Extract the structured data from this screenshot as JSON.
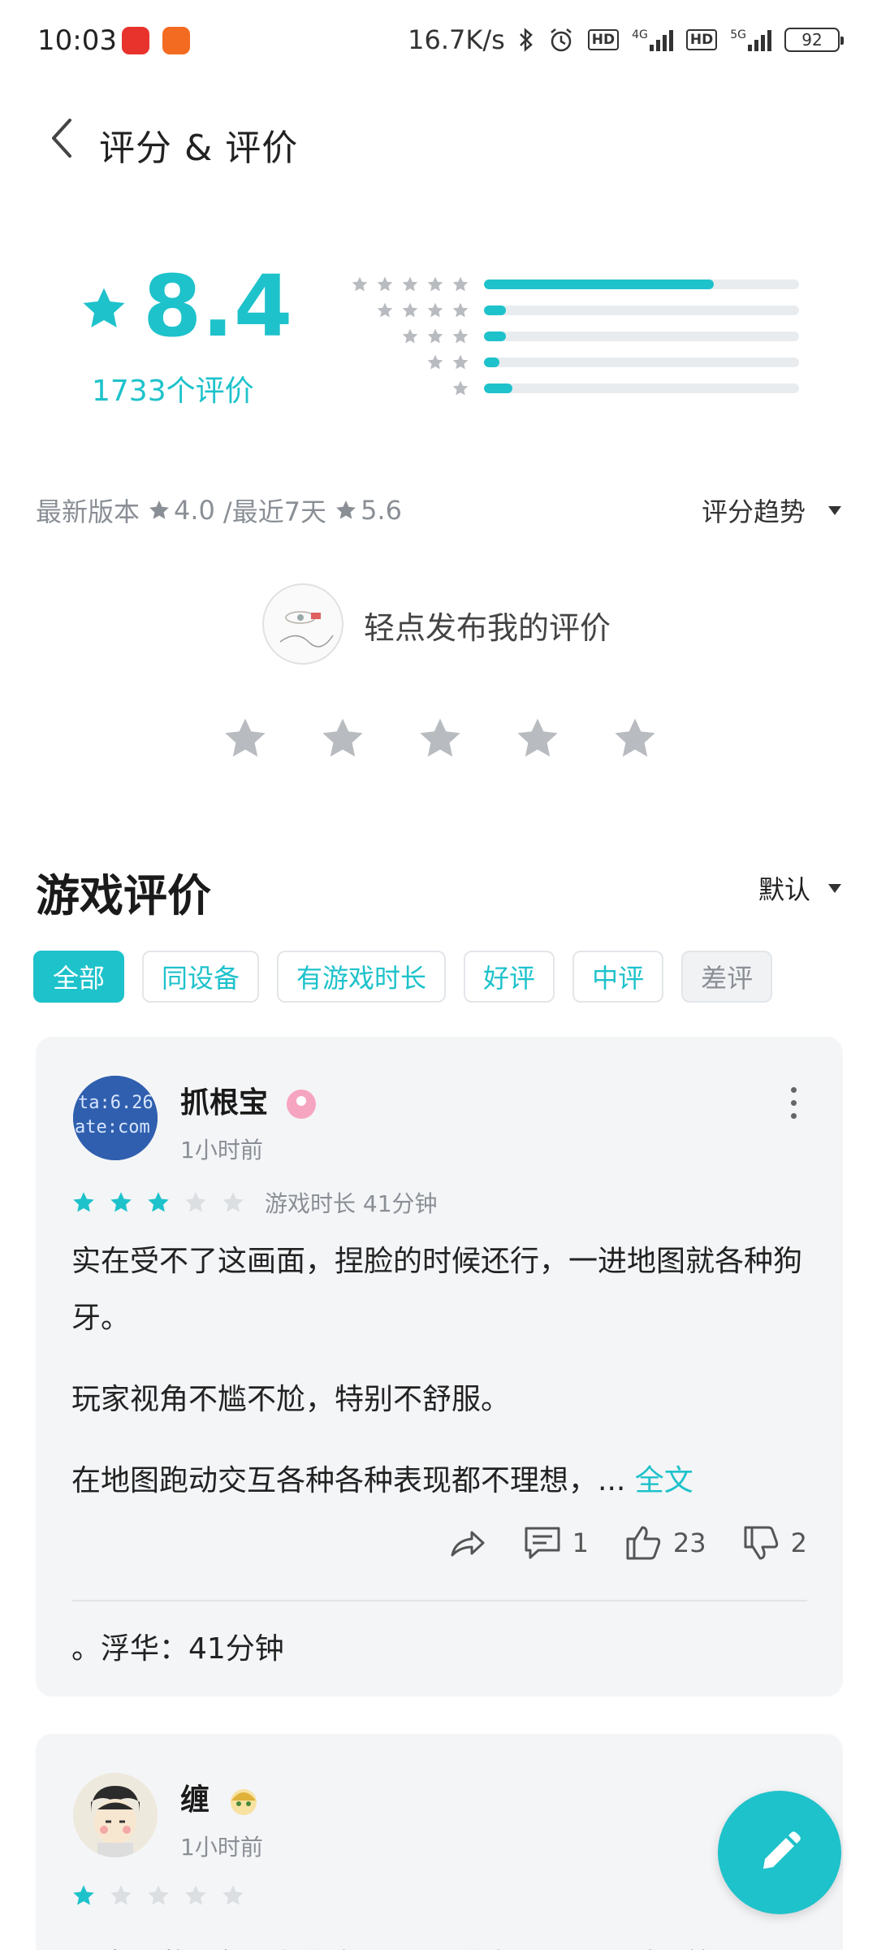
{
  "status_bar": {
    "time": "10:03",
    "net_speed": "16.7K/s",
    "hd1": "HD",
    "net1": "4G",
    "hd2": "HD",
    "net2": "5G",
    "battery": "92",
    "icons": [
      "app-red-icon",
      "app-orange-icon",
      "bluetooth-icon",
      "alarm-icon",
      "signal-icon",
      "battery-icon"
    ]
  },
  "header": {
    "title": "评分 & 评价"
  },
  "summary": {
    "score": "8.4",
    "count": "1733个评价",
    "distribution": [
      {
        "stars": 5,
        "fraction": 0.73
      },
      {
        "stars": 4,
        "fraction": 0.07
      },
      {
        "stars": 3,
        "fraction": 0.07
      },
      {
        "stars": 2,
        "fraction": 0.05
      },
      {
        "stars": 1,
        "fraction": 0.09
      }
    ]
  },
  "version_line": {
    "label": "最新版本",
    "latest": "4.0",
    "separator": "/最近7天",
    "recent": "5.6",
    "trend": "评分趋势"
  },
  "publish": {
    "prompt": "轻点发布我的评价",
    "star_count": 5
  },
  "reviews_section": {
    "title": "游戏评价",
    "sort": "默认",
    "filters": [
      {
        "label": "全部",
        "state": "active"
      },
      {
        "label": "同设备",
        "state": "normal"
      },
      {
        "label": "有游戏时长",
        "state": "normal"
      },
      {
        "label": "好评",
        "state": "normal"
      },
      {
        "label": "中评",
        "state": "normal"
      },
      {
        "label": "差评",
        "state": "muted"
      }
    ]
  },
  "reviews": [
    {
      "user": "抓根宝",
      "time": "1小时前",
      "rating": 3,
      "playtime": "游戏时长 41分钟",
      "paragraphs": [
        "实在受不了这画面，捏脸的时候还行，一进地图就各种狗牙。",
        "玩家视角不尴不尬，特别不舒服。"
      ],
      "last_line": "在地图跑动交互各种各种表现都不理想，...",
      "full_text": "全文",
      "comments": "1",
      "likes": "23",
      "dislikes": "2",
      "reply": "。浮华：41分钟"
    },
    {
      "user": "缠",
      "time": "1小时前",
      "rating": 1,
      "text": "七点下载，然后领红包，跟我说注册时间不对，第一"
    }
  ],
  "colors": {
    "accent": "#1ec2cb",
    "star_gray": "#b8bbbf",
    "card_bg": "#f4f5f7"
  }
}
